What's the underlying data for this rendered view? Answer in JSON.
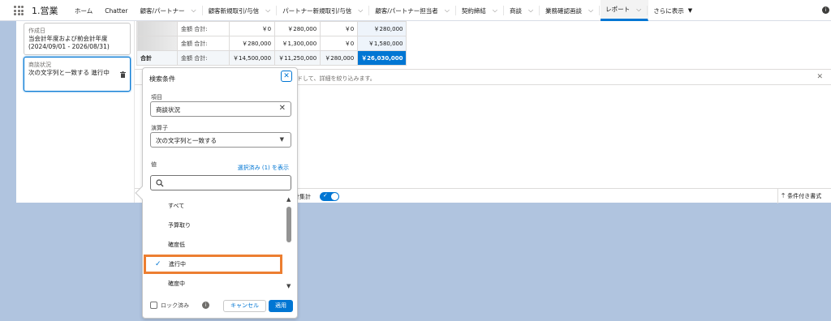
{
  "app": {
    "name": "1.営業"
  },
  "nav": {
    "tabs": [
      {
        "label": "ホーム",
        "chevron": false
      },
      {
        "label": "Chatter",
        "chevron": false
      },
      {
        "label": "顧客/パートナー",
        "chevron": true
      },
      {
        "label": "顧客新規取引/与信",
        "chevron": true
      },
      {
        "label": "パートナー新規取引/与信",
        "chevron": true
      },
      {
        "label": "顧客/パートナー担当者",
        "chevron": true
      },
      {
        "label": "契約締結",
        "chevron": true
      },
      {
        "label": "商談",
        "chevron": true
      },
      {
        "label": "業務確認画談",
        "chevron": true
      },
      {
        "label": "レポート",
        "chevron": true,
        "active": true
      },
      {
        "label": "さらに表示",
        "chevron": false
      }
    ]
  },
  "filters": {
    "created": {
      "label": "作成日",
      "value": "当会計年度および前会計年度 (2024/09/01 - 2026/08/31)"
    },
    "status": {
      "label": "商談状況",
      "value": "次の文字列と一致する 進行中"
    }
  },
  "table": {
    "rows": [
      {
        "label": "金額 合計:",
        "values": [
          "￥0",
          "￥280,000",
          "￥0",
          "￥280,000"
        ]
      },
      {
        "label": "金額 合計:",
        "values": [
          "￥280,000",
          "￥1,300,000",
          "￥0",
          "￥1,580,000"
        ]
      }
    ],
    "total": {
      "name": "合計",
      "label": "金額 合計:",
      "values": [
        "￥14,500,000",
        "￥11,250,000",
        "￥280,000",
        "￥26,030,000"
      ]
    }
  },
  "hint": {
    "text": "ドして、詳細を絞り込みます。"
  },
  "footer": {
    "row_totals": "計集計",
    "conditional_format": "条件付き書式"
  },
  "popover": {
    "title": "検索条件",
    "field_label": "項目",
    "field_value": "商談状況",
    "operator_label": "演算子",
    "operator_value": "次の文字列と一致する",
    "value_label": "値",
    "show_selected": "選択済み (1) を表示",
    "search_placeholder": "",
    "options": [
      {
        "label": "すべて",
        "checked": false
      },
      {
        "label": "予算取り",
        "checked": false
      },
      {
        "label": "確度低",
        "checked": false
      },
      {
        "label": "進行中",
        "checked": true
      },
      {
        "label": "確度中",
        "checked": false
      }
    ],
    "lock_label": "ロック済み",
    "cancel": "キャンセル",
    "apply": "適用"
  },
  "colors": {
    "accent": "#0176d3",
    "highlight": "#ec7e31",
    "background": "#b0c4df"
  }
}
